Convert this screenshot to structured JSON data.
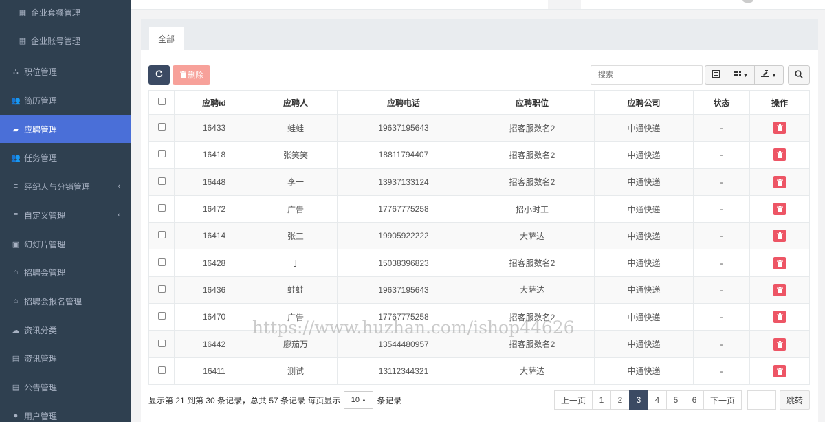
{
  "sidebar": {
    "items": [
      {
        "label": "企业套餐管理",
        "icon": "grid-icon"
      },
      {
        "label": "企业账号管理",
        "icon": "grid-icon"
      },
      {
        "label": "职位管理",
        "icon": "sitemap-icon"
      },
      {
        "label": "简历管理",
        "icon": "users-icon"
      },
      {
        "label": "应聘管理",
        "icon": "map-icon"
      },
      {
        "label": "任务管理",
        "icon": "users-icon"
      },
      {
        "label": "经纪人与分销管理",
        "icon": "list-icon",
        "arrow": "‹"
      },
      {
        "label": "自定义管理",
        "icon": "list-icon",
        "arrow": "‹"
      },
      {
        "label": "幻灯片管理",
        "icon": "image-icon"
      },
      {
        "label": "招聘会管理",
        "icon": "bank-icon"
      },
      {
        "label": "招聘会报名管理",
        "icon": "bank-icon"
      },
      {
        "label": "资讯分类",
        "icon": "cloud-icon"
      },
      {
        "label": "资讯管理",
        "icon": "news-icon"
      },
      {
        "label": "公告管理",
        "icon": "news-icon"
      },
      {
        "label": "用户管理",
        "icon": "user-icon"
      }
    ]
  },
  "tabs": {
    "active": "全部"
  },
  "toolbar": {
    "delete_label": "删除",
    "search_placeholder": "搜索"
  },
  "table": {
    "headers": [
      "应聘id",
      "应聘人",
      "应聘电话",
      "应聘职位",
      "应聘公司",
      "状态",
      "操作"
    ],
    "rows": [
      [
        "16433",
        "蛙蛙",
        "19637195643",
        "招客服数名2",
        "中通快递",
        "-"
      ],
      [
        "16418",
        "张笑笑",
        "18811794407",
        "招客服数名2",
        "中通快递",
        "-"
      ],
      [
        "16448",
        "李一",
        "13937133124",
        "招客服数名2",
        "中通快递",
        "-"
      ],
      [
        "16472",
        "广告",
        "17767775258",
        "招小时工",
        "中通快递",
        "-"
      ],
      [
        "16414",
        "张三",
        "19905922222",
        "大萨达",
        "中通快递",
        "-"
      ],
      [
        "16428",
        "丁",
        "15038396823",
        "招客服数名2",
        "中通快递",
        "-"
      ],
      [
        "16436",
        "蛙蛙",
        "19637195643",
        "大萨达",
        "中通快递",
        "-"
      ],
      [
        "16470",
        "广告",
        "17767775258",
        "招客服数名2",
        "中通快递",
        "-"
      ],
      [
        "16442",
        "廖茄万",
        "13544480957",
        "招客服数名2",
        "中通快递",
        "-"
      ],
      [
        "16411",
        "测试",
        "13112344321",
        "大萨达",
        "中通快递",
        "-"
      ]
    ]
  },
  "footer": {
    "info_prefix": "显示第 21 到第 30 条记录，总共 57 条记录 每页显示",
    "page_size": "10",
    "info_suffix": "条记录"
  },
  "pager": {
    "prev": "上一页",
    "pages": [
      "1",
      "2",
      "3",
      "4",
      "5",
      "6"
    ],
    "current": "3",
    "next": "下一页",
    "jump": "跳转"
  },
  "watermark": "https://www.huzhan.com/ishop44626",
  "colors": {
    "sidebar_bg": "#2f4050",
    "active_blue": "#4a6fd8",
    "dark_button": "#3b4a63",
    "danger": "#ed5565"
  }
}
